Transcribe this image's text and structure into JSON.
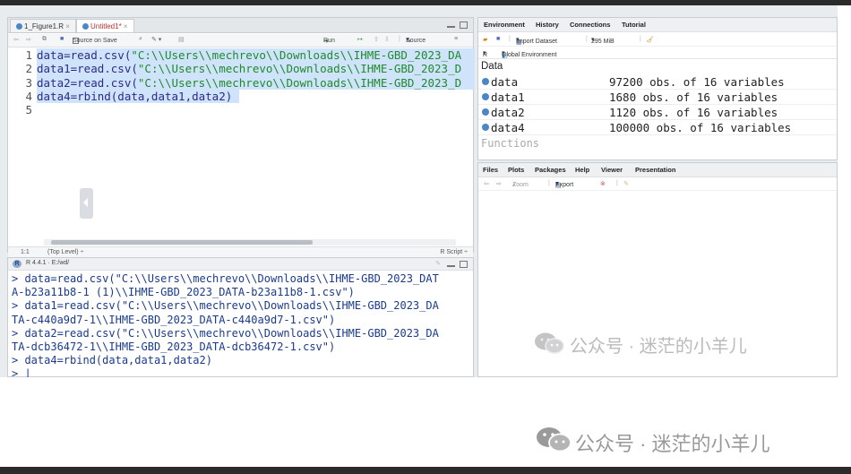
{
  "editor": {
    "tabs": [
      "1_Figure1.R",
      "Untitled1*"
    ],
    "toolbar": {
      "source_on_save": "Source on Save",
      "run": "Run",
      "source": "Source"
    },
    "lines": [
      {
        "n": "1",
        "a": "data=read.csv(",
        "s": "\"C:\\\\Users\\\\mechrevo\\\\Downloads\\\\IHME-GBD_2023_DA"
      },
      {
        "n": "2",
        "a": "data1=read.csv(",
        "s": "\"C:\\\\Users\\\\mechrevo\\\\Downloads\\\\IHME-GBD_2023_D"
      },
      {
        "n": "3",
        "a": "data2=read.csv(",
        "s": "\"C:\\\\Users\\\\mechrevo\\\\Downloads\\\\IHME-GBD_2023_D"
      },
      {
        "n": "4",
        "a": "data4=rbind(data,data1,data2)",
        "s": ""
      },
      {
        "n": "5",
        "a": "",
        "s": ""
      }
    ],
    "status": {
      "position": "1:1",
      "scope": "(Top Level) ÷",
      "type": "R Script ÷"
    }
  },
  "console": {
    "header": "R 4.4.1 · E:/wd/",
    "lines": [
      "> data=read.csv(\"C:\\\\Users\\\\mechrevo\\\\Downloads\\\\IHME-GBD_2023_DAT",
      "A-b23a11b8-1 (1)\\\\IHME-GBD_2023_DATA-b23a11b8-1.csv\")",
      "> data1=read.csv(\"C:\\\\Users\\\\mechrevo\\\\Downloads\\\\IHME-GBD_2023_DA",
      "TA-c440a9d7-1\\\\IHME-GBD_2023_DATA-c440a9d7-1.csv\")",
      "> data2=read.csv(\"C:\\\\Users\\\\mechrevo\\\\Downloads\\\\IHME-GBD_2023_DA",
      "TA-dcb36472-1\\\\IHME-GBD_2023_DATA-dcb36472-1.csv\")",
      "> data4=rbind(data,data1,data2)",
      "> |"
    ]
  },
  "environment": {
    "tabs": [
      "Environment",
      "History",
      "Connections",
      "Tutorial"
    ],
    "import_dataset": "Import Dataset",
    "memory": "295 MiB",
    "r_label": "R",
    "global_env": "Global Environment",
    "section_data": "Data",
    "section_functions": "Functions",
    "rows": [
      {
        "name": "data",
        "value": "97200 obs. of 16 variables"
      },
      {
        "name": "data1",
        "value": "1680 obs. of 16 variables"
      },
      {
        "name": "data2",
        "value": "1120 obs. of 16 variables"
      },
      {
        "name": "data4",
        "value": "100000 obs. of 16 variables"
      }
    ]
  },
  "files": {
    "tabs": [
      "Files",
      "Plots",
      "Packages",
      "Help",
      "Viewer",
      "Presentation"
    ],
    "zoom": "Zoom",
    "export": "Export"
  },
  "watermark": {
    "text": "公众号 · 迷茫的小羊儿"
  },
  "colors": {
    "selection": "#cfe3fb",
    "string": "#1f8a2b",
    "console_text": "#1a3b8c",
    "object_dot": "#4b86c5"
  }
}
